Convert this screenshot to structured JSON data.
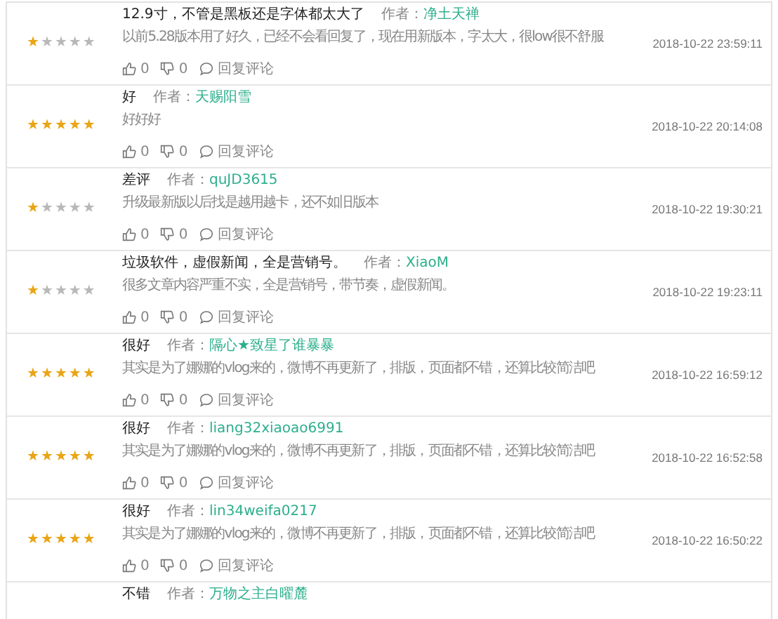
{
  "reviews": [
    {
      "stars": 1,
      "title": "12.9寸，不管是黑板还是字体都太大了",
      "author_label": "作者：",
      "author": "净土天禅",
      "body": "以前5.28版本用了好久，已经不会看回复了，现在用新版本，字太大，很low很不舒服",
      "time": "2018-10-22 23:59:11",
      "likes": "0",
      "dislikes": "0",
      "reply": "回复评论"
    },
    {
      "stars": 5,
      "title": "好",
      "author_label": "作者：",
      "author": "天赐阳雪",
      "body": "好好好",
      "time": "2018-10-22 20:14:08",
      "likes": "0",
      "dislikes": "0",
      "reply": "回复评论"
    },
    {
      "stars": 1,
      "title": "差评",
      "author_label": "作者：",
      "author": "quJD3615",
      "body": "升级最新版以后找是越用越卡，还不如旧版本",
      "time": "2018-10-22 19:30:21",
      "likes": "0",
      "dislikes": "0",
      "reply": "回复评论"
    },
    {
      "stars": 1,
      "title": "垃圾软件，虚假新闻，全是营销号。",
      "author_label": "作者：",
      "author": "XiaoM",
      "body": "很多文章内容严重不实，全是营销号，带节奏，虚假新闻。",
      "time": "2018-10-22 19:23:11",
      "likes": "0",
      "dislikes": "0",
      "reply": "回复评论"
    },
    {
      "stars": 5,
      "title": "很好",
      "author_label": "作者：",
      "author": "隔心★致星了谁暴暴",
      "body": "其实是为了娜娜的vlog来的，微博不再更新了，排版，页面都不错，还算比较简洁吧",
      "time": "2018-10-22 16:59:12",
      "likes": "0",
      "dislikes": "0",
      "reply": "回复评论"
    },
    {
      "stars": 5,
      "title": "很好",
      "author_label": "作者：",
      "author": "liang32xiaoao6991",
      "body": "其实是为了娜娜的vlog来的，微博不再更新了，排版，页面都不错，还算比较简洁吧",
      "time": "2018-10-22 16:52:58",
      "likes": "0",
      "dislikes": "0",
      "reply": "回复评论"
    },
    {
      "stars": 5,
      "title": "很好",
      "author_label": "作者：",
      "author": "lin34weifa0217",
      "body": "其实是为了娜娜的vlog来的，微博不再更新了，排版，页面都不错，还算比较简洁吧",
      "time": "2018-10-22 16:50:22",
      "likes": "0",
      "dislikes": "0",
      "reply": "回复评论"
    },
    {
      "title": "不错",
      "author_label": "作者：",
      "author": "万物之主白曜麓"
    }
  ]
}
